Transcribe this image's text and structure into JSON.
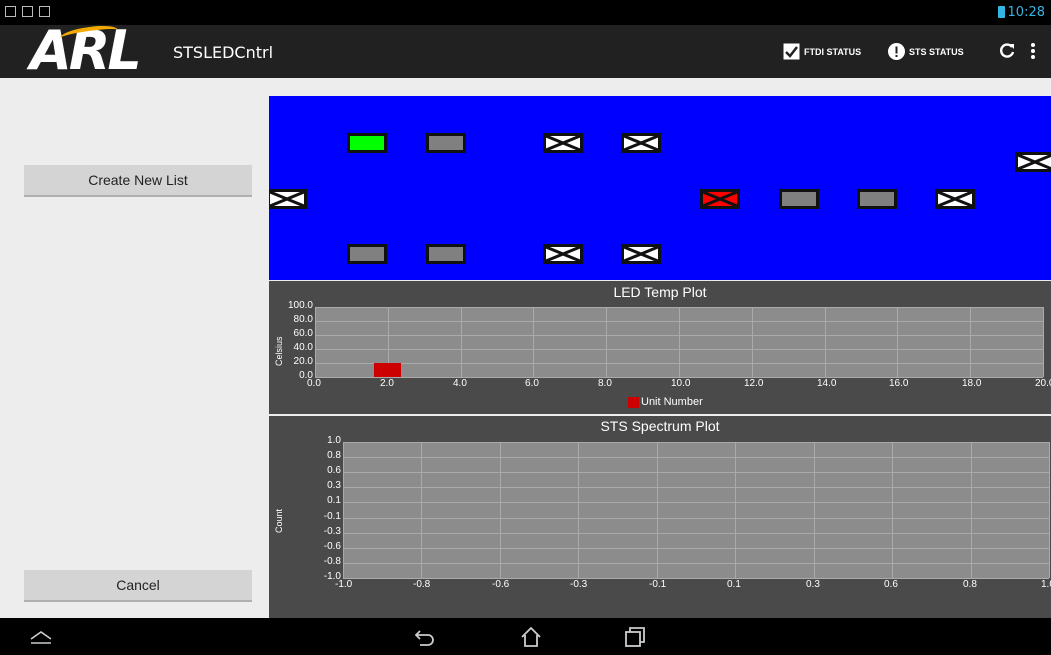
{
  "status_bar": {
    "time": "10:28"
  },
  "action_bar": {
    "logo_text": "ARL",
    "app_title": "STSLEDCntrl",
    "ftdi_status_label": "FTDI STATUS",
    "sts_status_label": "STS STATUS"
  },
  "sidebar": {
    "create_button_label": "Create New List",
    "cancel_button_label": "Cancel"
  },
  "led_panel": {
    "background": "#0000ff",
    "leds": [
      {
        "state": "on"
      },
      {
        "state": "off"
      },
      {
        "state": "disabled"
      },
      {
        "state": "disabled"
      },
      {
        "state": "disabled"
      },
      {
        "state": "disabled-red"
      },
      {
        "state": "off"
      },
      {
        "state": "off"
      },
      {
        "state": "disabled"
      },
      {
        "state": "disabled"
      },
      {
        "state": "off"
      },
      {
        "state": "off"
      },
      {
        "state": "disabled"
      },
      {
        "state": "disabled"
      }
    ]
  },
  "led_temp_plot": {
    "title": "LED Temp Plot",
    "ylabel": "Celsius",
    "legend": "Unit Number",
    "legend_color": "#cc0000",
    "yticks": [
      "100.0",
      "80.0",
      "60.0",
      "40.0",
      "20.0",
      "0.0"
    ],
    "xticks": [
      "0.0",
      "2.0",
      "4.0",
      "6.0",
      "8.0",
      "10.0",
      "12.0",
      "14.0",
      "16.0",
      "18.0",
      "20.0"
    ],
    "chart_data": {
      "type": "bar",
      "x": [
        2.0
      ],
      "values": [
        20.0
      ],
      "xlim": [
        0,
        20
      ],
      "ylim": [
        0,
        100
      ]
    }
  },
  "sts_spectrum_plot": {
    "title": "STS Spectrum Plot",
    "ylabel": "Count",
    "yticks": [
      "1.0",
      "0.8",
      "0.6",
      "0.3",
      "0.1",
      "-0.1",
      "-0.3",
      "-0.6",
      "-0.8",
      "-1.0"
    ],
    "xticks": [
      "-1.0",
      "-0.8",
      "-0.6",
      "-0.3",
      "-0.1",
      "0.1",
      "0.3",
      "0.6",
      "0.8",
      "1.0"
    ]
  }
}
